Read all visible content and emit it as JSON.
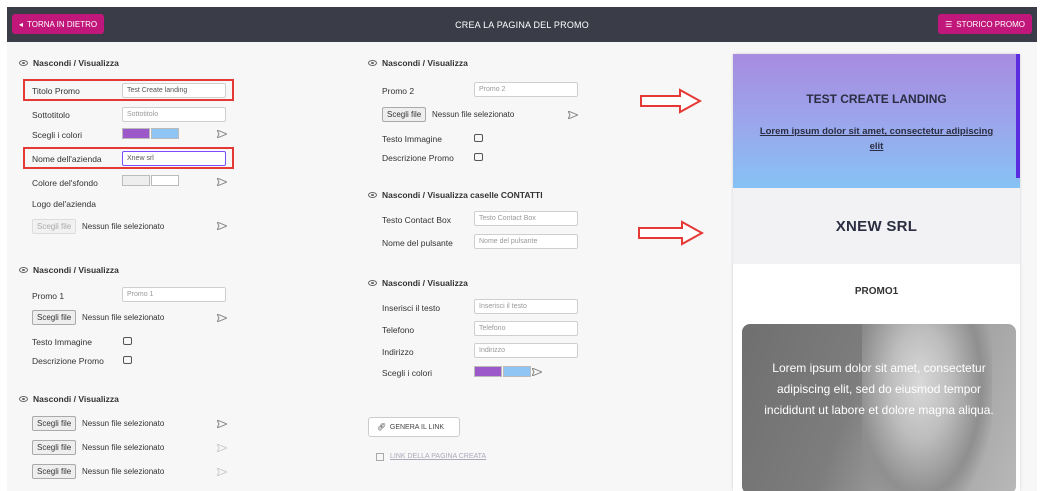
{
  "topbar": {
    "back_label": "TORNA IN DIETRO",
    "title": "CREA LA PAGINA DEL PROMO",
    "history_label": "STORICO PROMO"
  },
  "left": {
    "section1": {
      "title": "Nascondi / Visualizza",
      "titolo_label": "Titolo Promo",
      "titolo_value": "Test Create landing",
      "sottotitolo_label": "Sottotitolo",
      "sottotitolo_placeholder": "Sottotitolo",
      "colori_label": "Scegli i colori",
      "azienda_label": "Nome dell'azienda",
      "azienda_value": "Xnew srl",
      "sfondo_label": "Colore del'sfondo",
      "logo_label": "Logo del'azienda",
      "file_btn": "Scegli file",
      "file_txt": "Nessun file selezionato"
    },
    "section2": {
      "title": "Nascondi / Visualizza",
      "promo_label": "Promo 1",
      "promo_placeholder": "Promo 1",
      "file_btn": "Scegli file",
      "file_txt": "Nessun file selezionato",
      "testo_immagine": "Testo Immagine",
      "descrizione": "Descrizione Promo"
    },
    "section3": {
      "title": "Nascondi / Visualizza",
      "rows": [
        {
          "btn": "Scegli file",
          "txt": "Nessun file selezionato"
        },
        {
          "btn": "Scegli file",
          "txt": "Nessun file selezionato"
        },
        {
          "btn": "Scegli file",
          "txt": "Nessun file selezionato"
        }
      ]
    }
  },
  "middle": {
    "section1": {
      "title": "Nascondi / Visualizza",
      "promo_label": "Promo 2",
      "promo_placeholder": "Promo 2",
      "file_btn": "Scegli file",
      "file_txt": "Nessun file selezionato",
      "testo_immagine": "Testo Immagine",
      "descrizione": "Descrizione Promo"
    },
    "section2": {
      "title": "Nascondi / Visualizza caselle CONTATTI",
      "contact_label": "Testo Contact Box",
      "contact_placeholder": "Testo Contact Box",
      "pulsante_label": "Nome del pulsante",
      "pulsante_placeholder": "Nome del pulsante"
    },
    "section3": {
      "title": "Nascondi / Visualizza",
      "testo_label": "Inserisci il testo",
      "testo_placeholder": "Inserisci il testo",
      "telefono_label": "Telefono",
      "telefono_placeholder": "Telefono",
      "indirizzo_label": "Indirizzo",
      "indirizzo_placeholder": "Indirizzo",
      "colori_label": "Scegli i colori"
    },
    "genera_label": "GENERA IL LINK",
    "link_label": "LINK DELLA PAGINA CREATA"
  },
  "preview": {
    "title": "TEST CREATE LANDING",
    "subtitle": "Lorem ipsum dolor sit amet, consectetur adipiscing elit",
    "company": "XNEW SRL",
    "promo": "PROMO1",
    "card_text": "Lorem ipsum dolor sit amet, consectetur adipiscing elit, sed do eiusmod tempor incididunt ut labore et dolore magna aliqua."
  },
  "colors": {
    "accent": "#c2177a",
    "topbar": "#3a3d48",
    "swatch_purple": "#9b59c9",
    "swatch_blue": "#8ec5f4",
    "annotation_red": "#e53935"
  }
}
